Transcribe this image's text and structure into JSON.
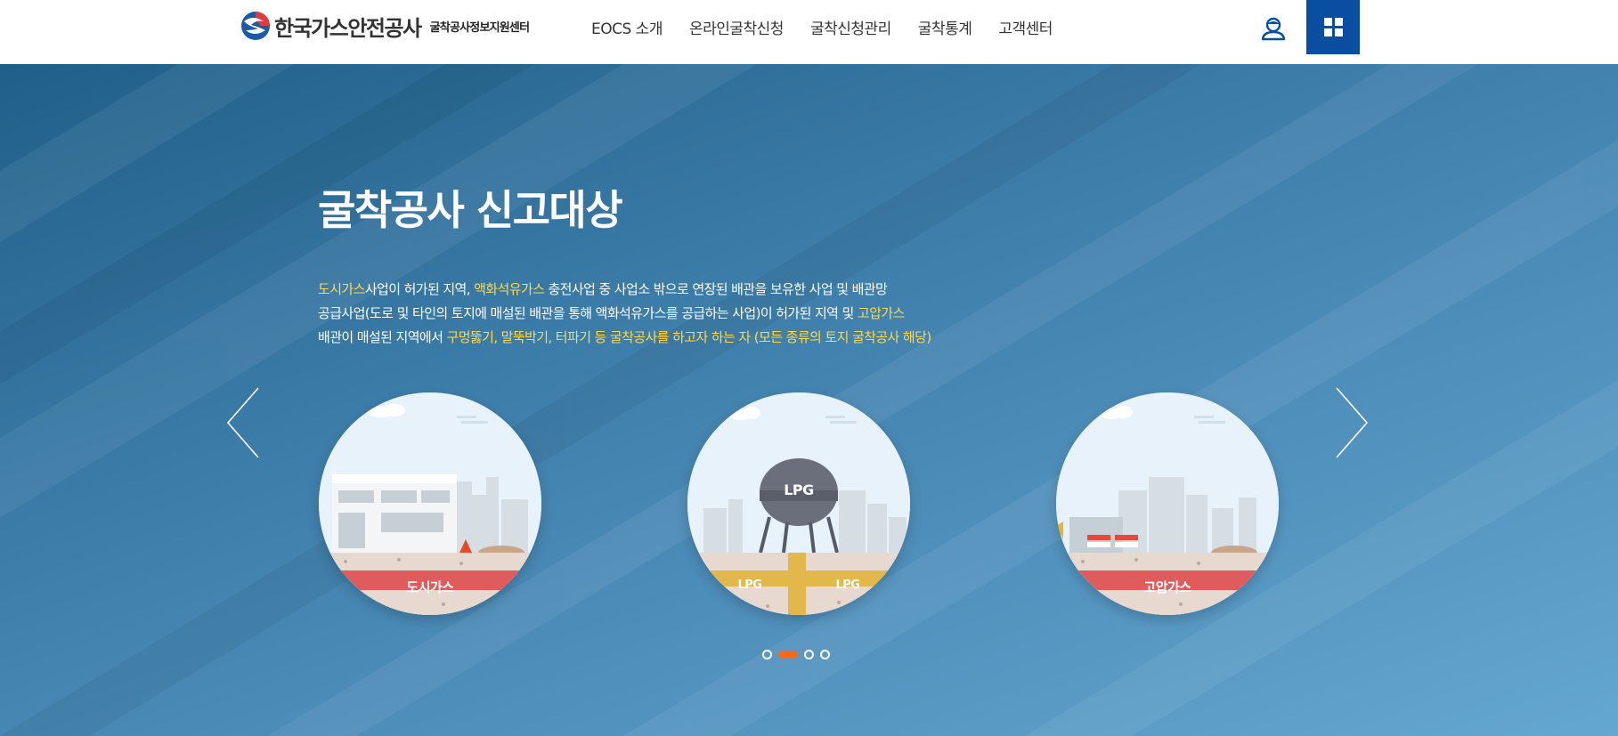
{
  "header": {
    "logo_title": "한국가스안전공사",
    "logo_subtitle": "굴착공사정보지원센터",
    "nav": [
      "EOCS 소개",
      "온라인굴착신청",
      "굴착신청관리",
      "굴착통계",
      "고객센터"
    ],
    "user_icon": "user-icon",
    "menu_icon": "grid-menu-icon",
    "accent_color": "#0a4ea1"
  },
  "hero": {
    "title": "굴착공사 신고대상",
    "desc": {
      "l1_hl1": "도시가스",
      "l1_t1": "사업이 허가된 지역, ",
      "l1_hl2": "액화석유가스",
      "l1_t2": " 충전사업 중 사업소 밖으로 연장된 배관을 보유한 사업 및 배관망",
      "l2_t1": "공급사업(도로 및 타인의 토지에 매설된 배관을 통해 액화석유가스를 공급하는 사업)이 허가된 지역 및 ",
      "l2_hl1": "고압가스",
      "l3_t1": "배관이 매설된 지역에서 ",
      "l3_hl1": "구멍뚫기, 말뚝박기, 터파기 등 굴착공사를 하고자 하는 자 (모든 종류의 토지 굴착공사 해당)"
    },
    "highlight_color": "#ffd94a",
    "cards": [
      {
        "label": "도시가스"
      },
      {
        "label": "LPG",
        "pipe_left": "LPG",
        "pipe_right": "LPG"
      },
      {
        "label": "고압가스"
      }
    ],
    "pagination": {
      "count": 4,
      "active": 1,
      "active_color": "#f26a1b"
    },
    "prev_icon": "chevron-left-icon",
    "next_icon": "chevron-right-icon"
  }
}
